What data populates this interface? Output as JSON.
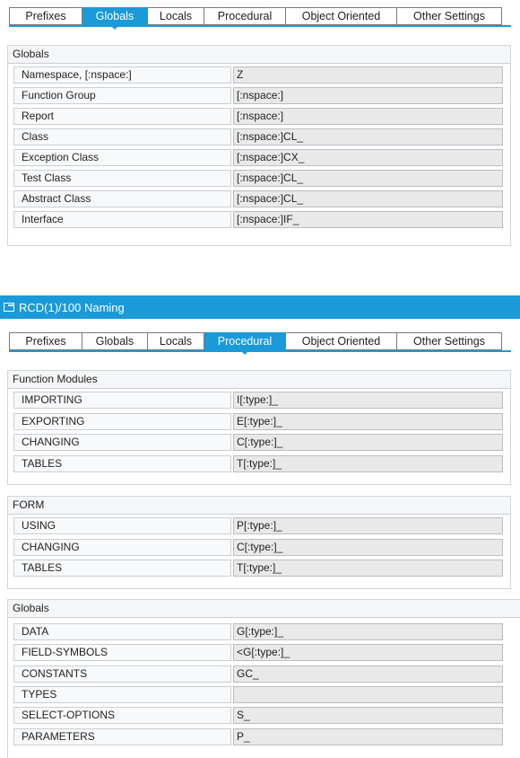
{
  "tabs": [
    "Prefixes",
    "Globals",
    "Locals",
    "Procedural",
    "Object Oriented",
    "Other Settings"
  ],
  "top_panel": {
    "active_tab": "Globals",
    "section_title": "Globals",
    "rows": [
      {
        "label": "Namespace, [:nspace:]",
        "value": "Z"
      },
      {
        "label": "Function Group",
        "value": "[:nspace:]"
      },
      {
        "label": "Report",
        "value": "[:nspace:]"
      },
      {
        "label": "Class",
        "value": "[:nspace:]CL_"
      },
      {
        "label": "Exception Class",
        "value": "[:nspace:]CX_"
      },
      {
        "label": "Test Class",
        "value": "[:nspace:]CL_"
      },
      {
        "label": "Abstract Class",
        "value": "[:nspace:]CL_"
      },
      {
        "label": "Interface",
        "value": "[:nspace:]IF_"
      }
    ]
  },
  "window": {
    "title": "RCD(1)/100 Naming",
    "title_icon": "window-icon"
  },
  "bottom_panel": {
    "active_tab": "Procedural",
    "function_modules": {
      "title": "Function Modules",
      "rows": [
        {
          "label": "IMPORTING",
          "value": "I[:type:]_"
        },
        {
          "label": "EXPORTING",
          "value": "E[:type:]_"
        },
        {
          "label": "CHANGING",
          "value": "C[:type:]_"
        },
        {
          "label": "TABLES",
          "value": "T[:type:]_"
        }
      ]
    },
    "form": {
      "title": "FORM",
      "rows": [
        {
          "label": "USING",
          "value": "P[:type:]_"
        },
        {
          "label": "CHANGING",
          "value": "C[:type:]_"
        },
        {
          "label": "TABLES",
          "value": "T[:type:]_"
        }
      ]
    },
    "globals": {
      "title": "Globals",
      "rows": [
        {
          "label": "DATA",
          "value": "G[:type:]_"
        },
        {
          "label": "FIELD-SYMBOLS",
          "value": "<G[:type:]_"
        },
        {
          "label": "CONSTANTS",
          "value": "GC_"
        },
        {
          "label": "TYPES",
          "value": ""
        },
        {
          "label": "SELECT-OPTIONS",
          "value": "S_"
        },
        {
          "label": "PARAMETERS",
          "value": "P_"
        }
      ]
    }
  },
  "colors": {
    "accent": "#1a9ad9",
    "field_bg": "#e9e9e9"
  }
}
